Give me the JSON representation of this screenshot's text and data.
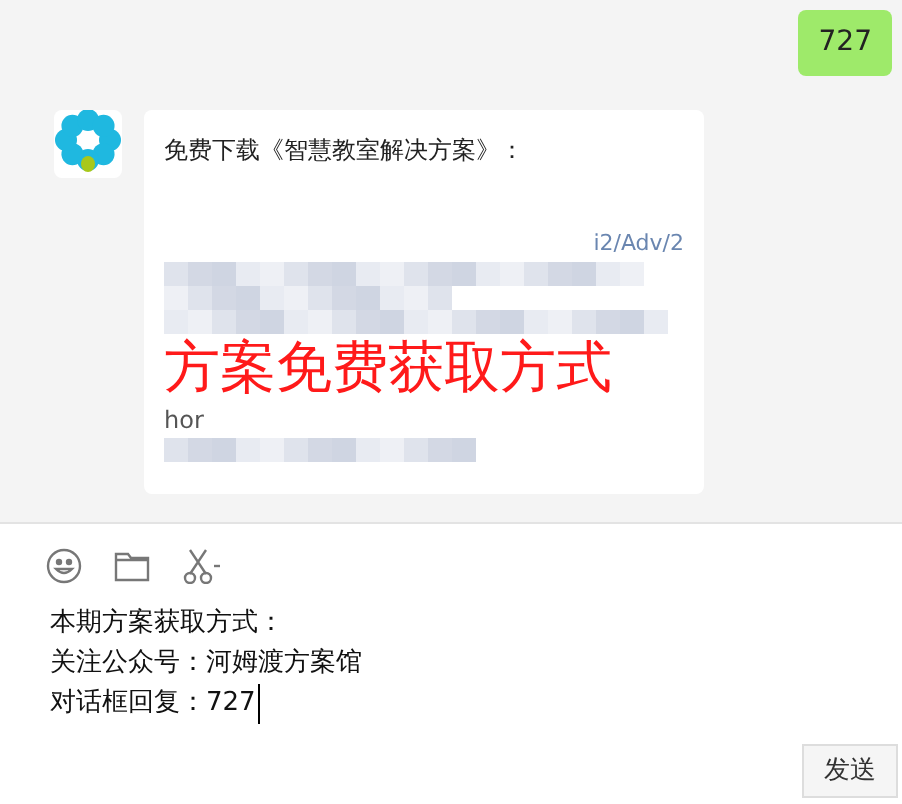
{
  "messages": [
    {
      "kind": "sent",
      "text": "727"
    },
    {
      "kind": "received",
      "title": "免费下载《智慧教室解决方案》：",
      "link_fragment": "i2/Adv/2",
      "overlay": "方案免费获取方式",
      "fragment": "hor"
    }
  ],
  "composer": {
    "lines": [
      "本期方案获取方式：",
      "关注公众号：河姆渡方案馆",
      "对话框回复：727"
    ],
    "send": "发送"
  }
}
